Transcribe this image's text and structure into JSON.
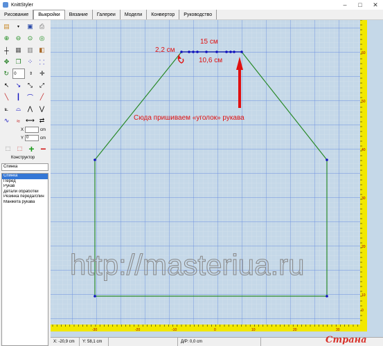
{
  "window": {
    "title": "KnittStyler"
  },
  "menu": {
    "tabs": [
      {
        "label": "Рисование",
        "active": false
      },
      {
        "label": "Выкройки",
        "active": true
      },
      {
        "label": "Вязание",
        "active": false
      },
      {
        "label": "Галереи",
        "active": false
      },
      {
        "label": "Модели",
        "active": false
      },
      {
        "label": "Конвертор",
        "active": false
      },
      {
        "label": "Руководство",
        "active": false
      }
    ]
  },
  "tools": {
    "rotate_value": "0",
    "x_value": "",
    "y_value": "0",
    "x_label": "X",
    "y_label": "Y",
    "unit": "cm",
    "add_symbol": "+",
    "remove_symbol": "−"
  },
  "constructor": {
    "label": "Конструктор",
    "selected": "Спинка",
    "pieces": [
      "Спинка",
      "Перед",
      "Рукав",
      "Детали обработки",
      "Резинка переда/спин",
      "Манжета рукава"
    ]
  },
  "annotations": {
    "width_top": "15 см",
    "left_segment": "2,2 см",
    "right_segment": "10,6 см",
    "note": "Сюда пришиваем «уголок» рукава",
    "watermark": "http://masteriua.ru"
  },
  "ruler": {
    "x_labels": [
      "-30",
      "-20",
      "-10",
      "0",
      "10",
      "20",
      "30"
    ],
    "y_labels": [
      "60",
      "50",
      "40",
      "30",
      "20",
      "10",
      "0"
    ]
  },
  "status": {
    "x": "X: -20,9 cm",
    "y": "Y: 58,1 cm",
    "dist": "Д/Р: 0,0 cm"
  },
  "logo": {
    "text": "Страна Мам"
  },
  "colors": {
    "outline": "#2a8a2a",
    "annotation": "#e01010",
    "grid_bg": "#c5d8e8",
    "points": "#1010c0"
  }
}
